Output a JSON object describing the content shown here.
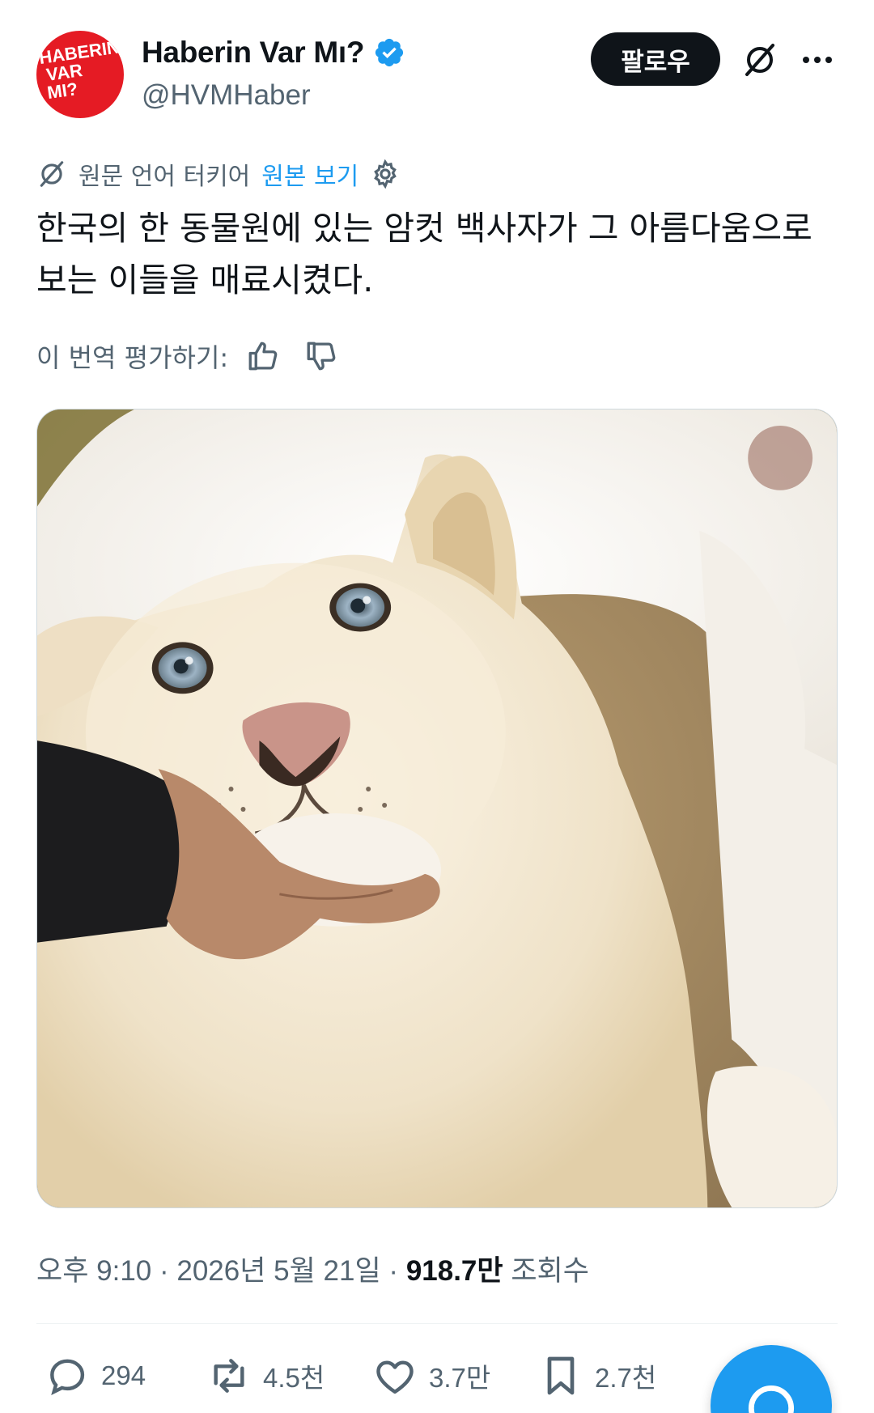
{
  "account": {
    "avatar_text": [
      "HABERIN",
      "VAR",
      "MI?"
    ],
    "display_name": "Haberin Var Mı?",
    "handle": "@HVMHaber",
    "follow_label": "팔로우"
  },
  "translation": {
    "note": "원문 언어 터키어",
    "show_original": "원본 보기"
  },
  "tweet": {
    "text": "한국의 한 동물원에 있는 암컷 백사자가 그 아름다움으로 보는 이들을 매료시켰다."
  },
  "rating": {
    "label": "이 번역 평가하기:"
  },
  "meta": {
    "time": "오후 9:10",
    "date": "2026년 5월 21일",
    "views_count": "918.7만",
    "views_label": "조회수"
  },
  "actions": {
    "replies": "294",
    "reposts": "4.5천",
    "likes": "3.7만",
    "bookmarks": "2.7천"
  },
  "colors": {
    "accent": "#1d9bf0",
    "brand_avatar": "#e51b24",
    "text_primary": "#0f1419",
    "text_secondary": "#536471"
  },
  "icons": [
    "verified-badge-icon",
    "translate-icon",
    "more-icon",
    "settings-icon",
    "thumbs-up-icon",
    "thumbs-down-icon",
    "reply-icon",
    "repost-icon",
    "like-icon",
    "bookmark-icon",
    "compose-icon"
  ]
}
